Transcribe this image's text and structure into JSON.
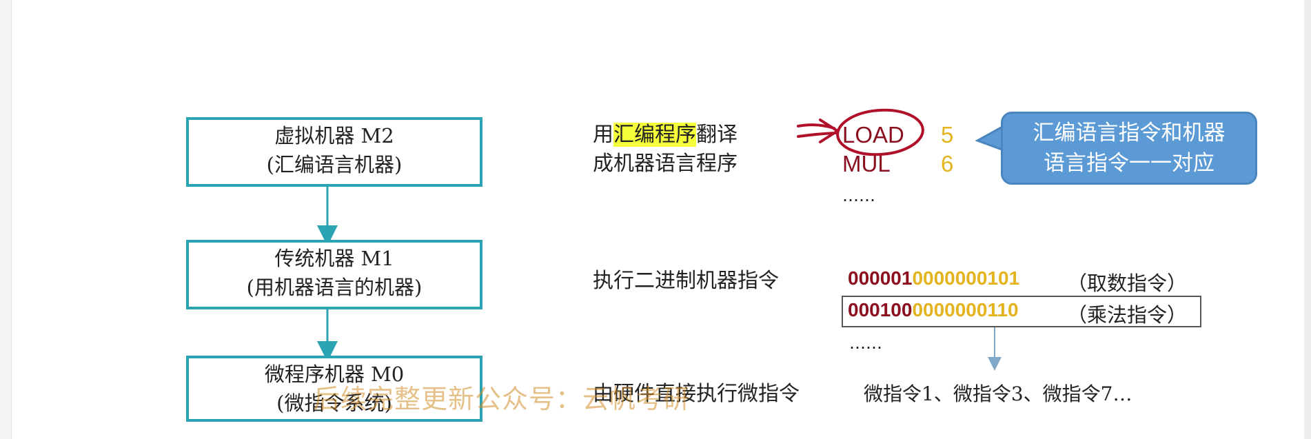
{
  "levels": [
    {
      "title": "虚拟机器 M2",
      "subtitle": "(汇编语言机器)"
    },
    {
      "title": "传统机器 M1",
      "subtitle": "(用机器语言的机器)"
    },
    {
      "title": "微程序机器 M0",
      "subtitle": "(微指令系统)"
    }
  ],
  "assemble": {
    "prefix": "用",
    "highlight": "汇编程序",
    "suffix": "翻译",
    "line2": "成机器语言程序"
  },
  "asm_code": [
    {
      "op": "LOAD",
      "arg": "5"
    },
    {
      "op": "MUL",
      "arg": "6"
    }
  ],
  "asm_ellipsis": "……",
  "callout": {
    "line1": "汇编语言指令和机器",
    "line2": "语言指令一一对应"
  },
  "execute": {
    "label": "执行二进制机器指令",
    "instructions": [
      {
        "opcode": "000001",
        "address": "0000000101",
        "note": "（取数指令）"
      },
      {
        "opcode": "000100",
        "address": "0000000110",
        "note": "（乘法指令）"
      }
    ],
    "ellipsis": "……"
  },
  "hardware": {
    "label": "由硬件直接执行微指令",
    "micro": "微指令1、微指令3、微指令7…"
  },
  "watermark": "后续完整更新公众号：云帆考研",
  "colors": {
    "box_border": "#2aa3b3",
    "highlight": "#f4ff3a",
    "opcode": "#8b0f1e",
    "operand": "#e3b320",
    "callout": "#5b9ad5",
    "annotation": "#b0102a"
  }
}
